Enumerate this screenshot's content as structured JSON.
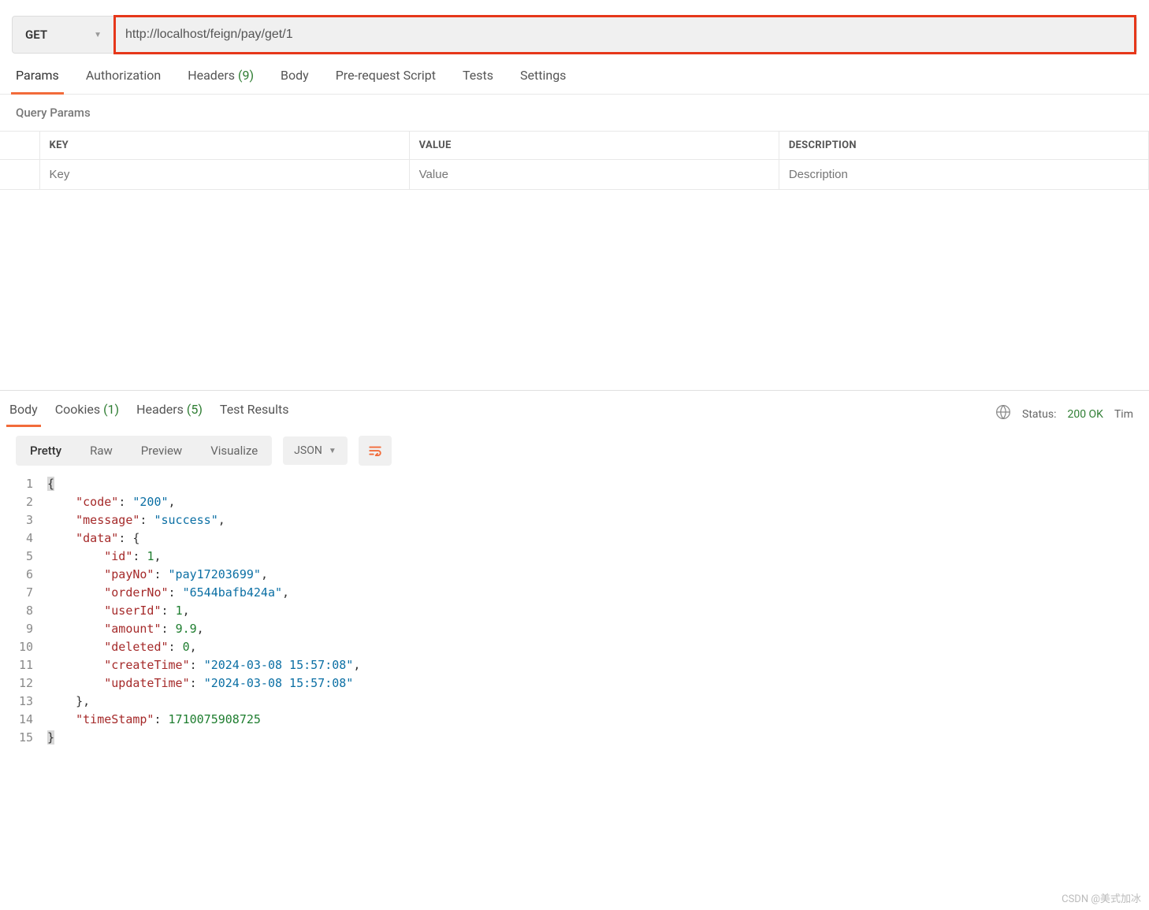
{
  "request": {
    "method": "GET",
    "url": "http://localhost/feign/pay/get/1"
  },
  "request_tabs": [
    {
      "label": "Params",
      "active": true
    },
    {
      "label": "Authorization"
    },
    {
      "label": "Headers",
      "count": "(9)"
    },
    {
      "label": "Body"
    },
    {
      "label": "Pre-request Script"
    },
    {
      "label": "Tests"
    },
    {
      "label": "Settings"
    }
  ],
  "query_section_label": "Query Params",
  "params_table": {
    "headers": {
      "key": "KEY",
      "value": "VALUE",
      "desc": "DESCRIPTION"
    },
    "placeholders": {
      "key": "Key",
      "value": "Value",
      "desc": "Description"
    }
  },
  "response_tabs": [
    {
      "label": "Body",
      "active": true
    },
    {
      "label": "Cookies",
      "count": "(1)"
    },
    {
      "label": "Headers",
      "count": "(5)"
    },
    {
      "label": "Test Results"
    }
  ],
  "status": {
    "label": "Status:",
    "value": "200 OK",
    "time_label": "Tim"
  },
  "view_modes": [
    "Pretty",
    "Raw",
    "Preview",
    "Visualize"
  ],
  "active_view": "Pretty",
  "format": "JSON",
  "json_lines": [
    {
      "n": 1,
      "indent": 0,
      "tokens": [
        {
          "t": "brace",
          "v": "{"
        }
      ]
    },
    {
      "n": 2,
      "indent": 1,
      "tokens": [
        {
          "t": "key",
          "v": "\"code\""
        },
        {
          "t": "punc",
          "v": ": "
        },
        {
          "t": "str",
          "v": "\"200\""
        },
        {
          "t": "punc",
          "v": ","
        }
      ]
    },
    {
      "n": 3,
      "indent": 1,
      "tokens": [
        {
          "t": "key",
          "v": "\"message\""
        },
        {
          "t": "punc",
          "v": ": "
        },
        {
          "t": "str",
          "v": "\"success\""
        },
        {
          "t": "punc",
          "v": ","
        }
      ]
    },
    {
      "n": 4,
      "indent": 1,
      "tokens": [
        {
          "t": "key",
          "v": "\"data\""
        },
        {
          "t": "punc",
          "v": ": {"
        }
      ]
    },
    {
      "n": 5,
      "indent": 2,
      "tokens": [
        {
          "t": "key",
          "v": "\"id\""
        },
        {
          "t": "punc",
          "v": ": "
        },
        {
          "t": "num",
          "v": "1"
        },
        {
          "t": "punc",
          "v": ","
        }
      ]
    },
    {
      "n": 6,
      "indent": 2,
      "tokens": [
        {
          "t": "key",
          "v": "\"payNo\""
        },
        {
          "t": "punc",
          "v": ": "
        },
        {
          "t": "str",
          "v": "\"pay17203699\""
        },
        {
          "t": "punc",
          "v": ","
        }
      ]
    },
    {
      "n": 7,
      "indent": 2,
      "tokens": [
        {
          "t": "key",
          "v": "\"orderNo\""
        },
        {
          "t": "punc",
          "v": ": "
        },
        {
          "t": "str",
          "v": "\"6544bafb424a\""
        },
        {
          "t": "punc",
          "v": ","
        }
      ]
    },
    {
      "n": 8,
      "indent": 2,
      "tokens": [
        {
          "t": "key",
          "v": "\"userId\""
        },
        {
          "t": "punc",
          "v": ": "
        },
        {
          "t": "num",
          "v": "1"
        },
        {
          "t": "punc",
          "v": ","
        }
      ]
    },
    {
      "n": 9,
      "indent": 2,
      "tokens": [
        {
          "t": "key",
          "v": "\"amount\""
        },
        {
          "t": "punc",
          "v": ": "
        },
        {
          "t": "num",
          "v": "9.9"
        },
        {
          "t": "punc",
          "v": ","
        }
      ]
    },
    {
      "n": 10,
      "indent": 2,
      "tokens": [
        {
          "t": "key",
          "v": "\"deleted\""
        },
        {
          "t": "punc",
          "v": ": "
        },
        {
          "t": "num",
          "v": "0"
        },
        {
          "t": "punc",
          "v": ","
        }
      ]
    },
    {
      "n": 11,
      "indent": 2,
      "tokens": [
        {
          "t": "key",
          "v": "\"createTime\""
        },
        {
          "t": "punc",
          "v": ": "
        },
        {
          "t": "str",
          "v": "\"2024-03-08 15:57:08\""
        },
        {
          "t": "punc",
          "v": ","
        }
      ]
    },
    {
      "n": 12,
      "indent": 2,
      "tokens": [
        {
          "t": "key",
          "v": "\"updateTime\""
        },
        {
          "t": "punc",
          "v": ": "
        },
        {
          "t": "str",
          "v": "\"2024-03-08 15:57:08\""
        }
      ]
    },
    {
      "n": 13,
      "indent": 1,
      "tokens": [
        {
          "t": "punc",
          "v": "},"
        }
      ]
    },
    {
      "n": 14,
      "indent": 1,
      "tokens": [
        {
          "t": "key",
          "v": "\"timeStamp\""
        },
        {
          "t": "punc",
          "v": ": "
        },
        {
          "t": "num",
          "v": "1710075908725"
        }
      ]
    },
    {
      "n": 15,
      "indent": 0,
      "tokens": [
        {
          "t": "brace",
          "v": "}"
        }
      ]
    }
  ],
  "watermark": "CSDN @美式加冰"
}
